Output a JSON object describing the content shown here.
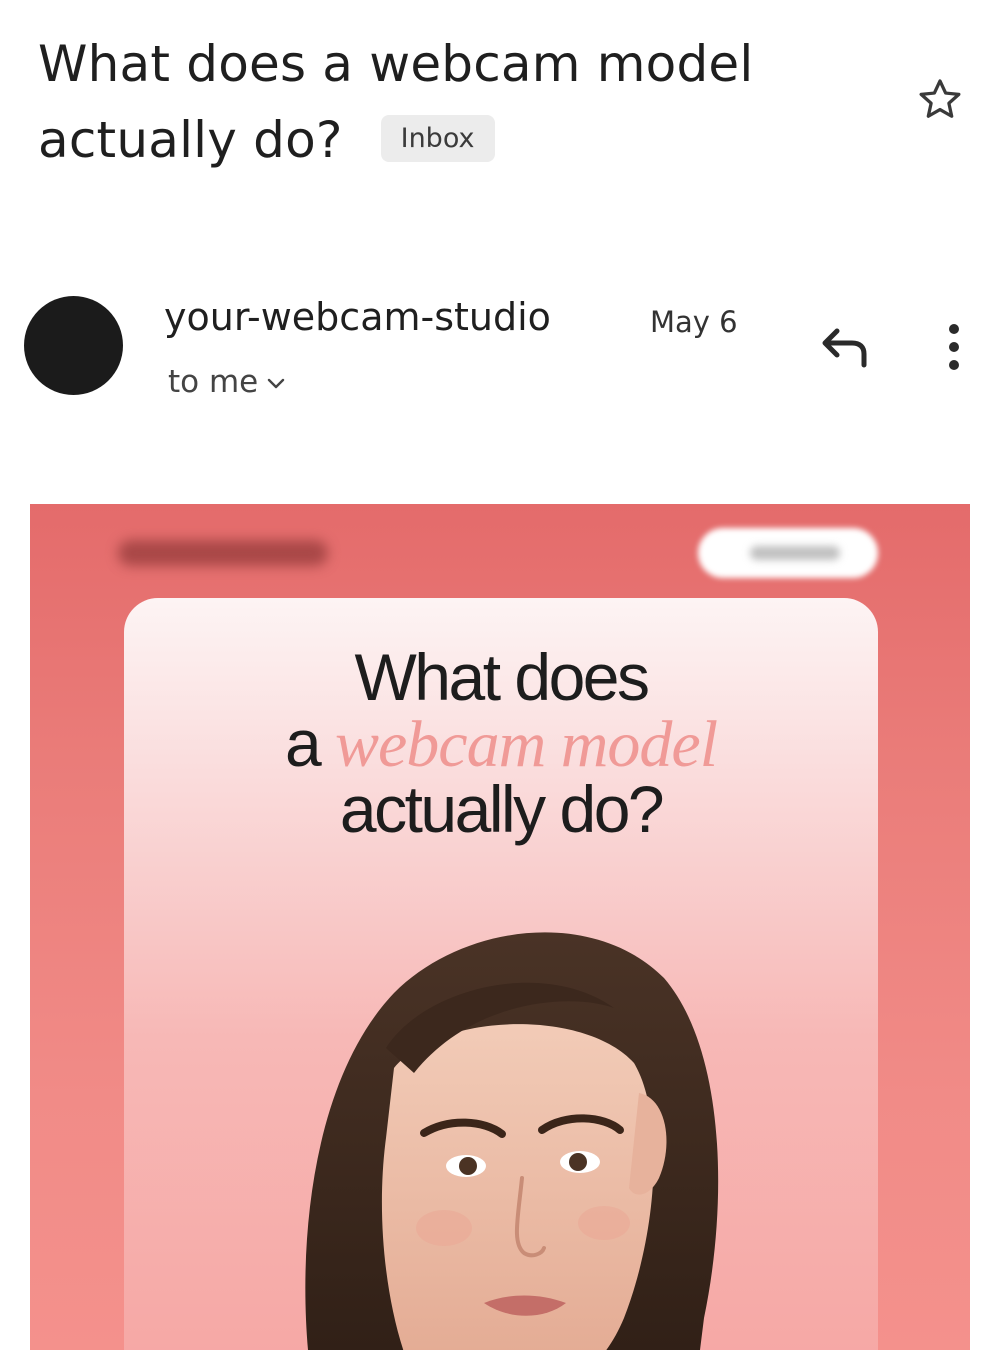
{
  "email": {
    "subject_line1": "What does a webcam model",
    "subject_line2": "actually do?",
    "label": "Inbox",
    "sender": "your-webcam-studio",
    "date": "May 6",
    "recipient": "to me",
    "icons": {
      "star": "star-outline-icon",
      "reply": "reply-icon",
      "more": "more-vert-icon",
      "expand": "chevron-down-icon"
    }
  },
  "banner": {
    "headline_line1": "What does",
    "headline_prefix": "a ",
    "headline_accent": "webcam model",
    "headline_line3": "actually do?",
    "colors": {
      "background": "#e46b6b",
      "accent_text": "#f09a97",
      "card_top": "#fdf4f4"
    }
  }
}
